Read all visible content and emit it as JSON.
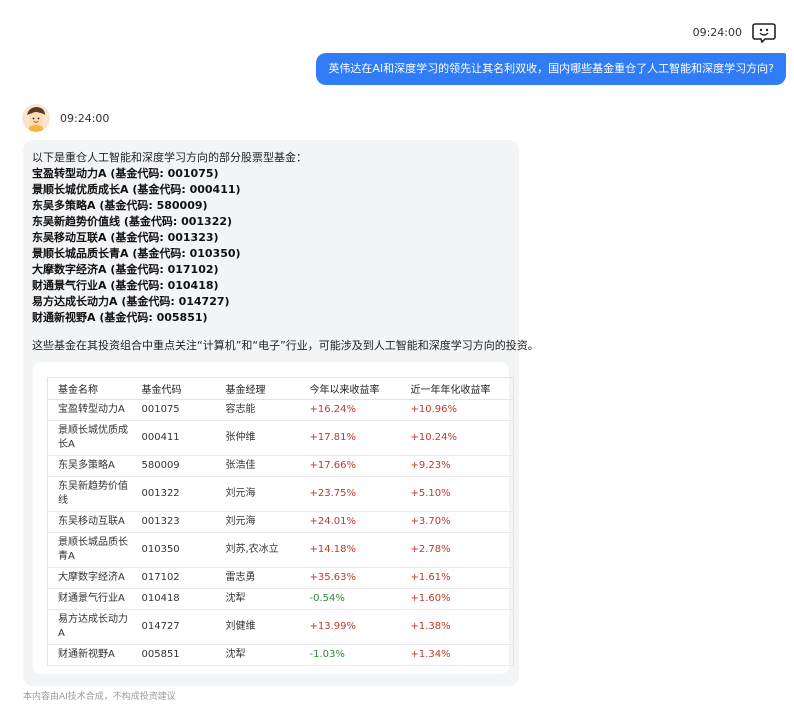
{
  "user_message": {
    "time": "09:24:00",
    "text": "英伟达在AI和深度学习的领先让其名利双收，国内哪些基金重仓了人工智能和深度学习方向?"
  },
  "bot_message": {
    "time": "09:24:00",
    "intro": "以下是重仓人工智能和深度学习方向的部分股票型基金：",
    "funds": [
      "宝盈转型动力A (基金代码: 001075)",
      "景顺长城优质成长A (基金代码: 000411)",
      "东吴多策略A (基金代码: 580009)",
      "东吴新趋势价值线 (基金代码: 001322)",
      "东吴移动互联A (基金代码: 001323)",
      "景顺长城品质长青A (基金代码: 010350)",
      "大摩数字经济A (基金代码: 017102)",
      "财通景气行业A (基金代码: 010418)",
      "易方达成长动力A (基金代码: 014727)",
      "财通新视野A (基金代码: 005851)"
    ],
    "summary": "这些基金在其投资组合中重点关注“计算机”和“电子”行业，可能涉及到人工智能和深度学习方向的投资。",
    "table": {
      "headers": [
        "基金名称",
        "基金代码",
        "基金经理",
        "今年以来收益率",
        "近一年年化收益率"
      ],
      "rows": [
        [
          "宝盈转型动力A",
          "001075",
          "容志能",
          "+16.24%",
          "+10.96%"
        ],
        [
          "景顺长城优质成长A",
          "000411",
          "张仲维",
          "+17.81%",
          "+10.24%"
        ],
        [
          "东吴多策略A",
          "580009",
          "张浩佳",
          "+17.66%",
          "+9.23%"
        ],
        [
          "东吴新趋势价值线",
          "001322",
          "刘元海",
          "+23.75%",
          "+5.10%"
        ],
        [
          "东吴移动互联A",
          "001323",
          "刘元海",
          "+24.01%",
          "+3.70%"
        ],
        [
          "景顺长城品质长青A",
          "010350",
          "刘苏,农冰立",
          "+14.18%",
          "+2.78%"
        ],
        [
          "大摩数字经济A",
          "017102",
          "雷志勇",
          "+35.63%",
          "+1.61%"
        ],
        [
          "财通景气行业A",
          "010418",
          "沈犁",
          "-0.54%",
          "+1.60%"
        ],
        [
          "易方达成长动力A",
          "014727",
          "刘健维",
          "+13.99%",
          "+1.38%"
        ],
        [
          "财通新视野A",
          "005851",
          "沈犁",
          "-1.03%",
          "+1.34%"
        ]
      ]
    }
  },
  "footer": "本内容由AI技术合成，不构成投资建议",
  "colors": {
    "user_bubble": "#2f7cf6",
    "positive": "#c0392b",
    "negative": "#2e8b3a"
  }
}
